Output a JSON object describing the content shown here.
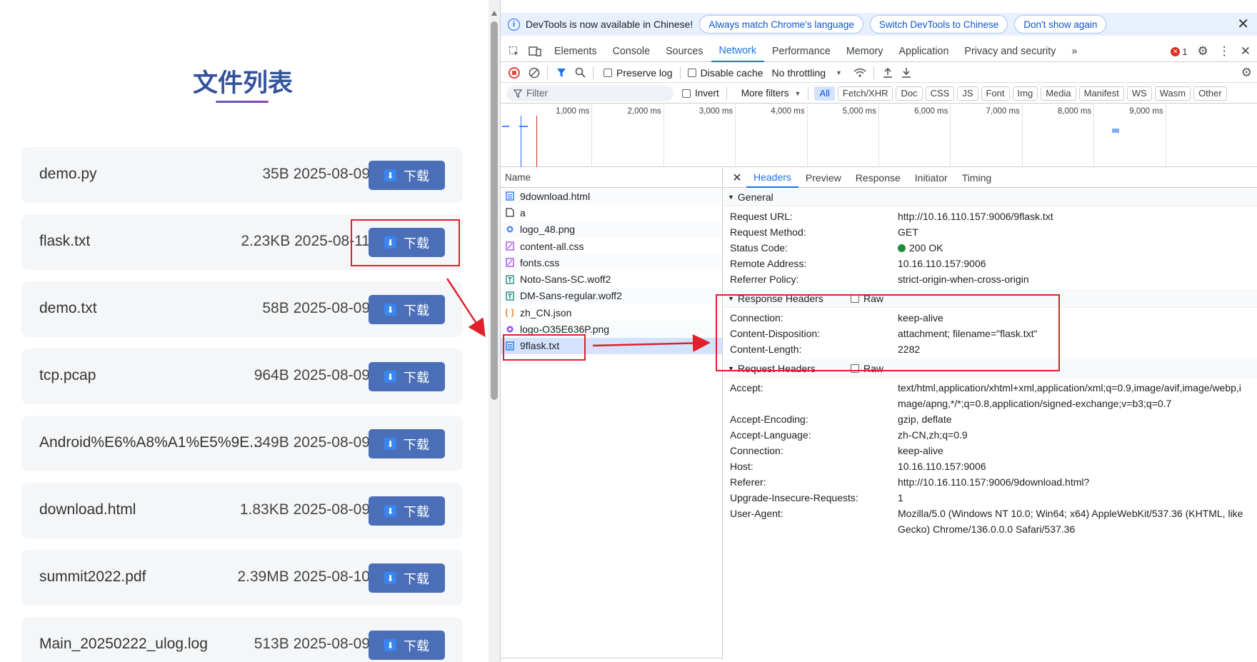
{
  "page": {
    "title": "文件列表",
    "download_label": "下载",
    "files": [
      {
        "name": "demo.py",
        "meta": "35B 2025-08-09"
      },
      {
        "name": "flask.txt",
        "meta": "2.23KB 2025-08-11"
      },
      {
        "name": "demo.txt",
        "meta": "58B 2025-08-09"
      },
      {
        "name": "tcp.pcap",
        "meta": "964B 2025-08-09"
      },
      {
        "name": "Android%E6%A8%A1%E5%9E...",
        "meta": "349B 2025-08-09"
      },
      {
        "name": "download.html",
        "meta": "1.83KB 2025-08-09"
      },
      {
        "name": "summit2022.pdf",
        "meta": "2.39MB 2025-08-10"
      },
      {
        "name": "Main_20250222_ulog.log",
        "meta": "513B 2025-08-09"
      }
    ]
  },
  "devtools": {
    "infobar": {
      "text": "DevTools is now available in Chinese!",
      "btn_match": "Always match Chrome's language",
      "btn_switch": "Switch DevTools to Chinese",
      "btn_dont": "Don't show again"
    },
    "tabs": [
      "Elements",
      "Console",
      "Sources",
      "Network",
      "Performance",
      "Memory",
      "Application",
      "Privacy and security"
    ],
    "active_tab": "Network",
    "error_count": "1",
    "toolbar": {
      "preserve_log": "Preserve log",
      "disable_cache": "Disable cache",
      "throttling": "No throttling"
    },
    "filter": {
      "placeholder": "Filter",
      "invert": "Invert",
      "more_filters": "More filters",
      "types": [
        "All",
        "Fetch/XHR",
        "Doc",
        "CSS",
        "JS",
        "Font",
        "Img",
        "Media",
        "Manifest",
        "WS",
        "Wasm",
        "Other"
      ]
    },
    "timeline_ticks": [
      "1,000 ms",
      "2,000 ms",
      "3,000 ms",
      "4,000 ms",
      "5,000 ms",
      "6,000 ms",
      "7,000 ms",
      "8,000 ms",
      "9,000 ms"
    ],
    "requests_header": "Name",
    "requests": [
      {
        "name": "9download.html",
        "icon": "doc-icon"
      },
      {
        "name": "a",
        "icon": "file-icon"
      },
      {
        "name": "logo_48.png",
        "icon": "image-icon"
      },
      {
        "name": "content-all.css",
        "icon": "css-icon"
      },
      {
        "name": "fonts.css",
        "icon": "css-icon"
      },
      {
        "name": "Noto-Sans-SC.woff2",
        "icon": "font-icon"
      },
      {
        "name": "DM-Sans-regular.woff2",
        "icon": "font-icon"
      },
      {
        "name": "zh_CN.json",
        "icon": "json-icon"
      },
      {
        "name": "logo-O35E636P.png",
        "icon": "image-icon"
      },
      {
        "name": "9flask.txt",
        "icon": "doc-icon"
      }
    ],
    "detail_tabs": [
      "Headers",
      "Preview",
      "Response",
      "Initiator",
      "Timing"
    ],
    "general": {
      "title": "General",
      "rows": [
        {
          "k": "Request URL:",
          "v": "http://10.16.110.157:9006/9flask.txt"
        },
        {
          "k": "Request Method:",
          "v": "GET"
        },
        {
          "k": "Status Code:",
          "v": "200 OK"
        },
        {
          "k": "Remote Address:",
          "v": "10.16.110.157:9006"
        },
        {
          "k": "Referrer Policy:",
          "v": "strict-origin-when-cross-origin"
        }
      ]
    },
    "response_headers": {
      "title": "Response Headers",
      "raw": "Raw",
      "rows": [
        {
          "k": "Connection:",
          "v": "keep-alive"
        },
        {
          "k": "Content-Disposition:",
          "v": "attachment; filename=\"flask.txt\""
        },
        {
          "k": "Content-Length:",
          "v": "2282"
        }
      ]
    },
    "request_headers": {
      "title": "Request Headers",
      "raw": "Raw",
      "rows": [
        {
          "k": "Accept:",
          "v": "text/html,application/xhtml+xml,application/xml;q=0.9,image/avif,image/webp,image/apng,*/*;q=0.8,application/signed-exchange;v=b3;q=0.7"
        },
        {
          "k": "Accept-Encoding:",
          "v": "gzip, deflate"
        },
        {
          "k": "Accept-Language:",
          "v": "zh-CN,zh;q=0.9"
        },
        {
          "k": "Connection:",
          "v": "keep-alive"
        },
        {
          "k": "Host:",
          "v": "10.16.110.157:9006"
        },
        {
          "k": "Referer:",
          "v": "http://10.16.110.157:9006/9download.html?"
        },
        {
          "k": "Upgrade-Insecure-Requests:",
          "v": "1"
        },
        {
          "k": "User-Agent:",
          "v": "Mozilla/5.0 (Windows NT 10.0; Win64; x64) AppleWebKit/537.36 (KHTML, like Gecko) Chrome/136.0.0.0 Safari/537.36"
        }
      ]
    }
  }
}
